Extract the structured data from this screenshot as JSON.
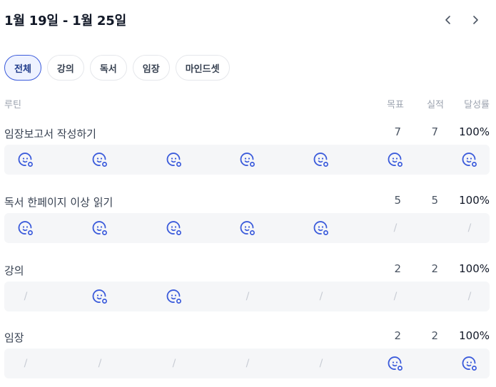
{
  "header": {
    "week_title": "1월 19일 - 1월 25일"
  },
  "icons": {
    "prev": "chevron-left-icon",
    "next": "chevron-right-icon",
    "done": "smiley-check-icon"
  },
  "colors": {
    "accent": "#3b5bdb",
    "day_bg": "#f5f6f8",
    "muted": "#9ca3af"
  },
  "chips": [
    {
      "label": "전체",
      "active": true
    },
    {
      "label": "강의",
      "active": false
    },
    {
      "label": "독서",
      "active": false
    },
    {
      "label": "임장",
      "active": false
    },
    {
      "label": "마인드셋",
      "active": false
    }
  ],
  "columns": {
    "routine": "루틴",
    "goal": "목표",
    "actual": "실적",
    "rate": "달성률"
  },
  "routines": [
    {
      "name": "임장보고서 작성하기",
      "goal": "7",
      "actual": "7",
      "rate": "100%",
      "days": [
        "done",
        "done",
        "done",
        "done",
        "done",
        "done",
        "done"
      ]
    },
    {
      "name": "독서 한페이지 이상 읽기",
      "goal": "5",
      "actual": "5",
      "rate": "100%",
      "days": [
        "done",
        "done",
        "done",
        "done",
        "done",
        "none",
        "none"
      ]
    },
    {
      "name": "강의",
      "goal": "2",
      "actual": "2",
      "rate": "100%",
      "days": [
        "none",
        "done",
        "done",
        "none",
        "none",
        "none",
        "none"
      ]
    },
    {
      "name": "임장",
      "goal": "2",
      "actual": "2",
      "rate": "100%",
      "days": [
        "none",
        "none",
        "none",
        "none",
        "none",
        "done",
        "done"
      ]
    }
  ]
}
